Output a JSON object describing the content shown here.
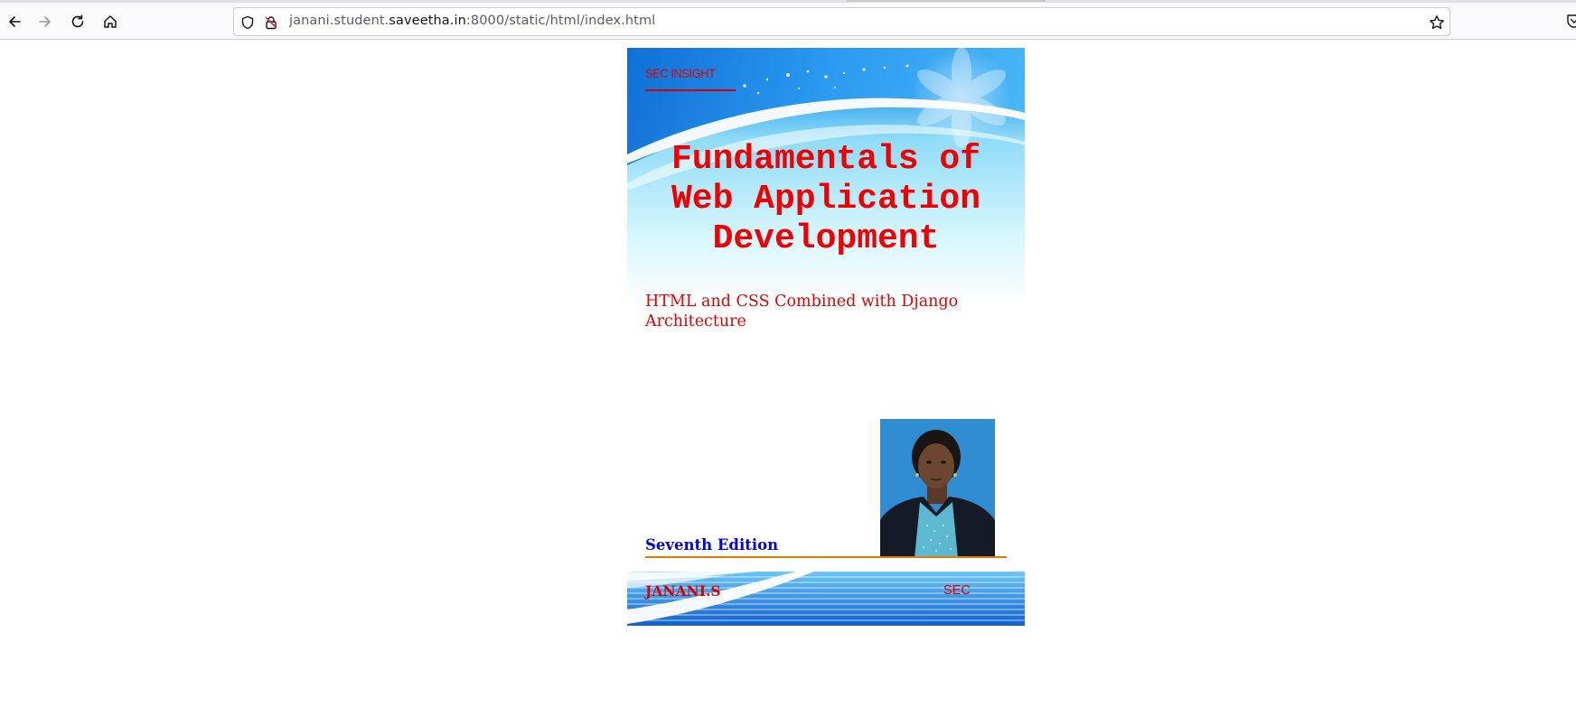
{
  "browser": {
    "url_prefix": "janani.student.",
    "url_domain": "saveetha.in",
    "url_suffix": ":8000/static/html/index.html"
  },
  "cover": {
    "series_label": "SEC INSIGHT",
    "title_lines": [
      "Fundamentals of",
      "Web Application",
      "Development"
    ],
    "subtitle": "HTML and CSS Combined with Django Architecture",
    "edition": "Seventh Edition",
    "author": "JANANI.S",
    "publisher": "SEC",
    "colors": {
      "title": "#f00000",
      "edition": "#0000e6",
      "rule": "#e07b00",
      "sky_top": "#1a7fe0",
      "sky_light": "#bdeefc"
    }
  }
}
